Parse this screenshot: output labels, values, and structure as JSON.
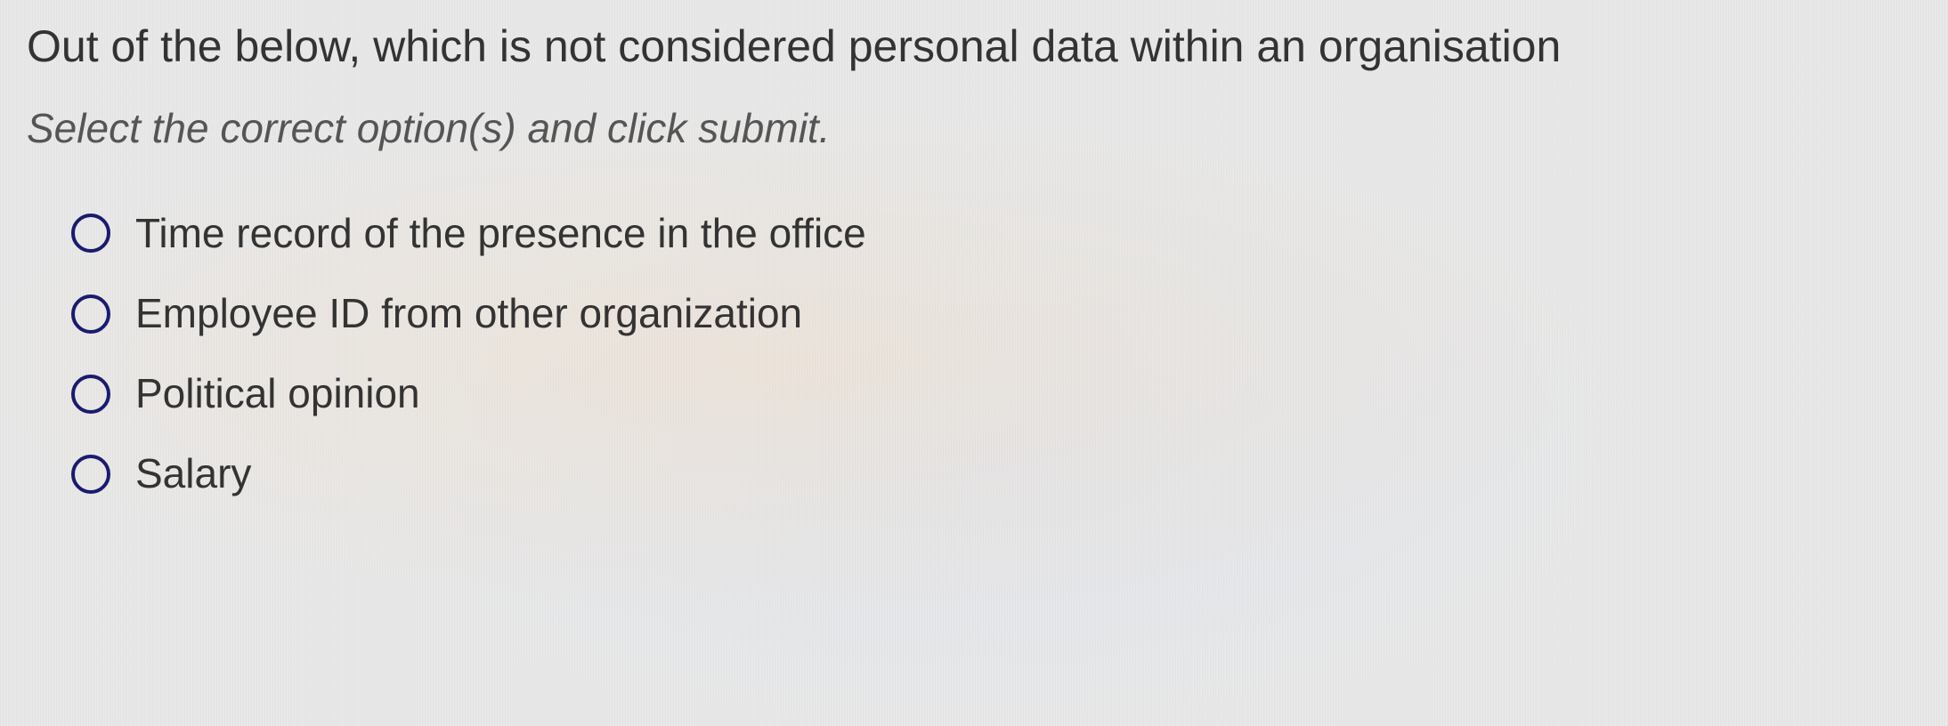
{
  "question": "Out of the below, which is not considered personal data within an organisation",
  "instruction": "Select the correct option(s) and click submit.",
  "options": [
    {
      "label": "Time record of the presence in the office"
    },
    {
      "label": "Employee ID from other organization"
    },
    {
      "label": "Political opinion"
    },
    {
      "label": "Salary"
    }
  ]
}
